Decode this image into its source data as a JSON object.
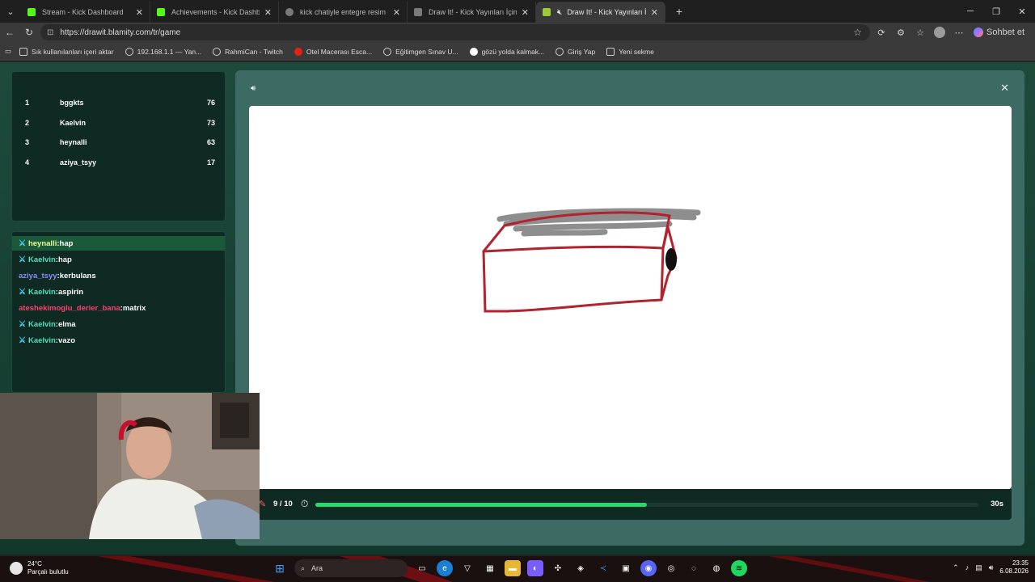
{
  "browser": {
    "tabs": [
      {
        "title": "Stream - Kick Dashboard",
        "color": "#53fc18"
      },
      {
        "title": "Achievements - Kick Dashboard",
        "color": "#53fc18"
      },
      {
        "title": "kick chatiyle entegre resim çizme",
        "color": "#7a7a7a"
      },
      {
        "title": "Draw It! - Kick Yayınları İçin Çizim",
        "color": "#7a7a7a"
      },
      {
        "title": "Draw It! - Kick Yayınları İçin Çi",
        "color": "#9acd32"
      }
    ],
    "url": "https://drawit.blamity.com/tr/game",
    "copilot_label": "Sohbet et",
    "bookmarks": [
      "Sık kullanılanları içeri aktar",
      "192.168.1.1 — Yan...",
      "RahmiCan - Twitch",
      "Otel Macerası Esca...",
      "Eğitimgen Sınav U...",
      "gözü yolda kalmak...",
      "Giriş Yap",
      "Yeni sekme"
    ]
  },
  "leaderboard": [
    {
      "rank": "1",
      "name": "bggkts",
      "score": "76"
    },
    {
      "rank": "2",
      "name": "Kaelvin",
      "score": "73"
    },
    {
      "rank": "3",
      "name": "heynalli",
      "score": "63"
    },
    {
      "rank": "4",
      "name": "aziya_tsyy",
      "score": "17"
    }
  ],
  "chat": [
    {
      "user": "heynalli",
      "message": "hap",
      "color": "#e9ff8c",
      "badge": true,
      "highlight": true
    },
    {
      "user": "Kaelvin",
      "message": "hap",
      "color": "#4ae0c0",
      "badge": true,
      "highlight": false
    },
    {
      "user": "aziya_tsyy",
      "message": "kerbulans",
      "color": "#8c8cff",
      "badge": false,
      "highlight": false
    },
    {
      "user": "Kaelvin",
      "message": "aspirin",
      "color": "#4ae0c0",
      "badge": true,
      "highlight": false
    },
    {
      "user": "ateshekimoglu_derier_bana",
      "message": "matrix",
      "color": "#ff3d6e",
      "badge": false,
      "highlight": false
    },
    {
      "user": "Kaelvin",
      "message": "elma",
      "color": "#4ae0c0",
      "badge": true,
      "highlight": false
    },
    {
      "user": "Kaelvin",
      "message": "vazo",
      "color": "#4ae0c0",
      "badge": true,
      "highlight": false
    }
  ],
  "game": {
    "round": "9 / 10",
    "progress": 0.5,
    "seconds": "30s"
  },
  "taskbar": {
    "temperature": "24°C",
    "weather": "Parçalı bulutlu",
    "search_label": "Ara",
    "time": "23:35",
    "date": "6.08.2026"
  }
}
